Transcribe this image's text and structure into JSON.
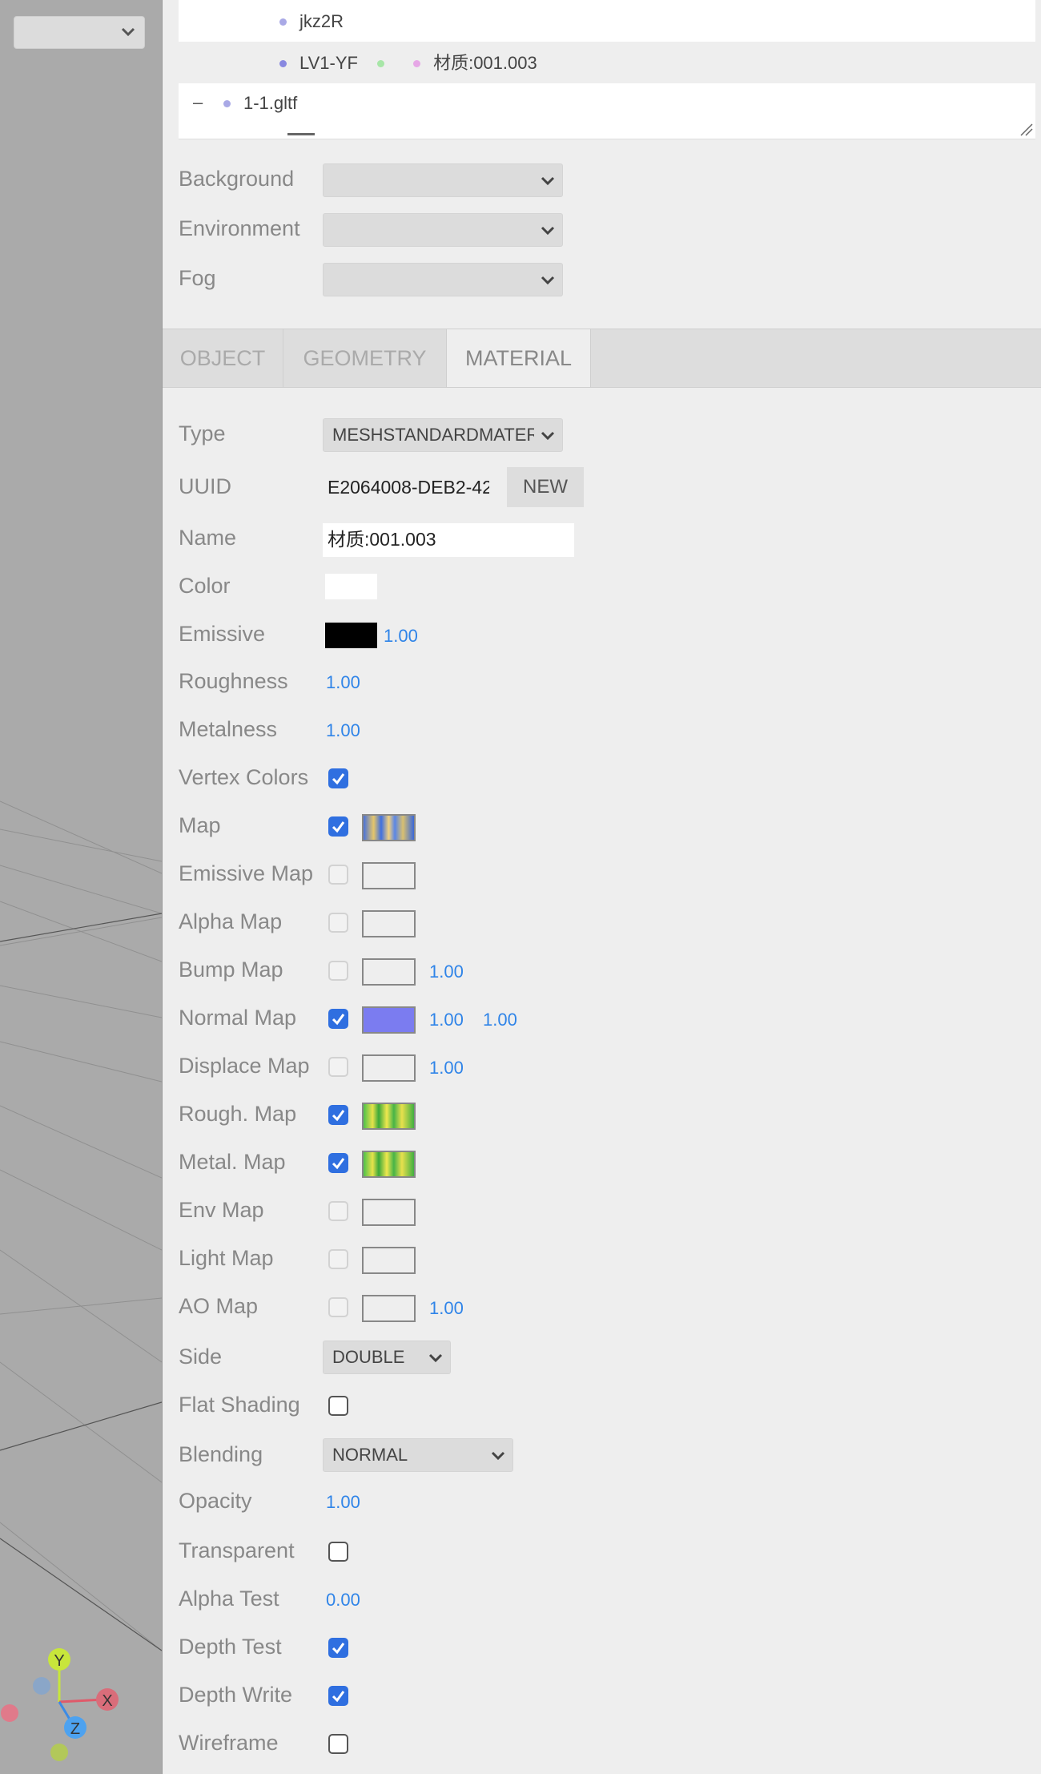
{
  "viewport": {
    "camera_select": "",
    "axes": {
      "y": "Y",
      "x": "X",
      "z": "Z"
    }
  },
  "outliner": {
    "rows": [
      {
        "label": "jkz2R",
        "dot_color": "#a9a9e6"
      },
      {
        "label": "LV1-YF",
        "dot_color": "#8888e0",
        "extra_dots": [
          "#a7e6a7",
          "#e6a7e6"
        ],
        "material": "材质:001.003"
      },
      {
        "label": "1-1.gltf",
        "dot_color": "#a9a9e6",
        "toggle": "–"
      }
    ]
  },
  "scene": {
    "background_label": "Background",
    "background_value": "",
    "environment_label": "Environment",
    "environment_value": "",
    "fog_label": "Fog",
    "fog_value": ""
  },
  "tabs": [
    {
      "label": "OBJECT",
      "active": false
    },
    {
      "label": "GEOMETRY",
      "active": false
    },
    {
      "label": "MATERIAL",
      "active": true
    }
  ],
  "material": {
    "type_label": "Type",
    "type_value": "MESHSTANDARDMATERIAL",
    "uuid_label": "UUID",
    "uuid_value": "E2064008-DEB2-42",
    "new_label": "NEW",
    "name_label": "Name",
    "name_value": "材质:001.003",
    "color_label": "Color",
    "color_value": "#ffffff",
    "emissive_label": "Emissive",
    "emissive_color": "#000000",
    "emissive_intensity": "1.00",
    "roughness_label": "Roughness",
    "roughness_value": "1.00",
    "metalness_label": "Metalness",
    "metalness_value": "1.00",
    "vertex_colors_label": "Vertex Colors",
    "vertex_colors": true,
    "maps": [
      {
        "label": "Map",
        "enabled": true,
        "texture": "map",
        "values": []
      },
      {
        "label": "Emissive Map",
        "enabled": false,
        "texture": "",
        "values": []
      },
      {
        "label": "Alpha Map",
        "enabled": false,
        "texture": "",
        "values": []
      },
      {
        "label": "Bump Map",
        "enabled": false,
        "texture": "",
        "values": [
          "1.00"
        ]
      },
      {
        "label": "Normal Map",
        "enabled": true,
        "texture": "normal",
        "values": [
          "1.00",
          "1.00"
        ]
      },
      {
        "label": "Displace Map",
        "enabled": false,
        "texture": "",
        "values": [
          "1.00"
        ]
      },
      {
        "label": "Rough. Map",
        "enabled": true,
        "texture": "green",
        "values": []
      },
      {
        "label": "Metal. Map",
        "enabled": true,
        "texture": "green",
        "values": []
      },
      {
        "label": "Env Map",
        "enabled": false,
        "texture": "",
        "values": []
      },
      {
        "label": "Light Map",
        "enabled": false,
        "texture": "",
        "values": []
      },
      {
        "label": "AO Map",
        "enabled": false,
        "texture": "",
        "values": [
          "1.00"
        ]
      }
    ],
    "side_label": "Side",
    "side_value": "DOUBLE",
    "flat_shading_label": "Flat Shading",
    "flat_shading": false,
    "blending_label": "Blending",
    "blending_value": "NORMAL",
    "opacity_label": "Opacity",
    "opacity_value": "1.00",
    "transparent_label": "Transparent",
    "transparent": false,
    "alpha_test_label": "Alpha Test",
    "alpha_test_value": "0.00",
    "depth_test_label": "Depth Test",
    "depth_test": true,
    "depth_write_label": "Depth Write",
    "depth_write": true,
    "wireframe_label": "Wireframe",
    "wireframe": false
  },
  "colors": {
    "accent": "#2f84e8",
    "checkbox_on": "#2f6fe0"
  }
}
